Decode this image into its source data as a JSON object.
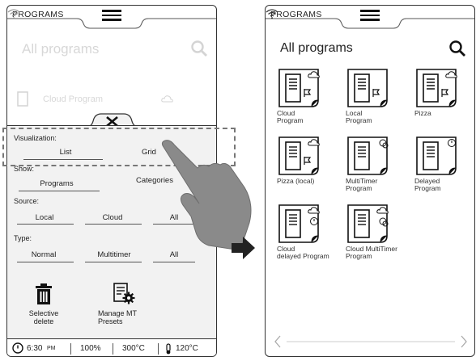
{
  "topbar": {
    "label": "PROGRAMS"
  },
  "left": {
    "title": "All programs",
    "bg_item": "Cloud Program",
    "panel": {
      "visualization": {
        "label": "Visualization:",
        "options": [
          "List",
          "Grid"
        ]
      },
      "show": {
        "label": "Show:",
        "options": [
          "Programs",
          "Categories"
        ]
      },
      "source": {
        "label": "Source:",
        "options": [
          "Local",
          "Cloud",
          "All"
        ]
      },
      "type": {
        "label": "Type:",
        "options": [
          "Normal",
          "Multitimer",
          "All"
        ]
      },
      "actions": {
        "selective_delete": "Selective\ndelete",
        "manage_mt": "Manage MT\nPresets"
      }
    },
    "status": {
      "time": "6:30",
      "ampm": "PM",
      "percent": "100%",
      "temp1": "300°C",
      "temp2": "120°C"
    }
  },
  "right": {
    "title": "All programs",
    "tiles": [
      {
        "label": "Cloud\nProgram",
        "badge": "cloud"
      },
      {
        "label": "Local\nProgram",
        "badge": "none"
      },
      {
        "label": "Pizza",
        "badge": "cloud"
      },
      {
        "label": "Pizza (local)",
        "badge": "cloud"
      },
      {
        "label": "MultiTimer\nProgram",
        "badge": "multitimer"
      },
      {
        "label": "Delayed\nProgram",
        "badge": "clock"
      },
      {
        "label": "Cloud\ndelayed Program",
        "badge": "cloud-clock"
      },
      {
        "label": "Cloud MultiTimer\nProgram",
        "badge": "cloud-multitimer"
      }
    ]
  },
  "colors": {
    "border": "#333333",
    "panel_bg": "#f2f2f2",
    "hand": "#8a8a8a",
    "arrow": "#222222"
  }
}
